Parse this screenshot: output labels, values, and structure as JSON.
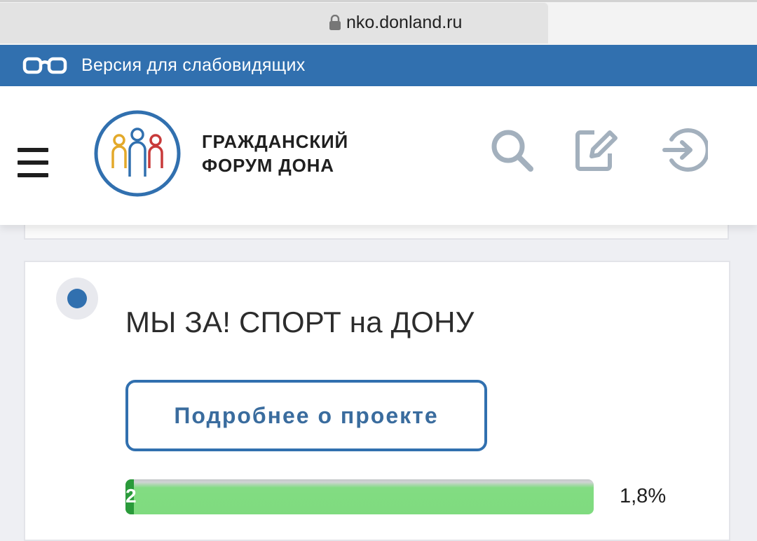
{
  "browser": {
    "url": "nko.donland.ru"
  },
  "accessibility_bar": {
    "label": "Версия для слабовидящих",
    "icon": "glasses-icon"
  },
  "header": {
    "logo_line1": "ГРАЖДАНСКИЙ",
    "logo_line2": "ФОРУМ ДОНА",
    "icons": [
      "menu-icon",
      "search-icon",
      "edit-icon",
      "login-icon"
    ]
  },
  "project": {
    "title": "МЫ ЗА! СПОРТ на ДОНУ",
    "details_button": "Подробнее о проекте",
    "progress": {
      "count": "2",
      "percent_label": "1,8%",
      "fraction": 0.018
    }
  },
  "colors": {
    "accent_blue": "#3170af",
    "progress_green": "#7fdb7f",
    "progress_fill_dark": "#2a9a3a"
  }
}
